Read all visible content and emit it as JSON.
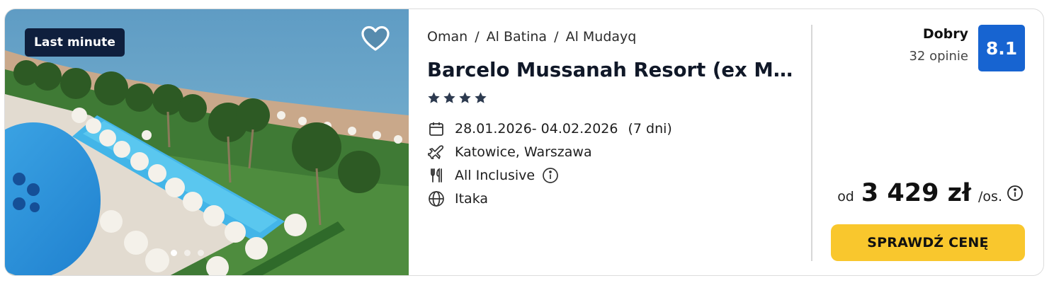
{
  "photo": {
    "badge": "Last minute",
    "favorite_icon": "heart-outline-icon",
    "carousel_dots": 3,
    "carousel_active_index": 0
  },
  "hotel": {
    "breadcrumb": [
      "Oman",
      "Al Batina",
      "Al Mudayq"
    ],
    "breadcrumb_separator": "/",
    "more_label": "•••",
    "name": "Barcelo Mussanah Resort (ex Mil...",
    "stars": 4,
    "dates": "28.01.2026- 04.02.2026",
    "nights": "(7 dni)",
    "departure": "Katowice, Warszawa",
    "board": "All Inclusive",
    "operator": "Itaka"
  },
  "rating": {
    "label": "Dobry",
    "reviews": "32 opinie",
    "score": "8.1"
  },
  "price": {
    "prefix": "od",
    "amount": "3 429 zł",
    "suffix": "/os."
  },
  "cta_label": "SPRAWDŹ CENĘ",
  "colors": {
    "badge_bg": "#0f1f3d",
    "score_bg": "#1764d1",
    "cta_bg": "#f9c72d",
    "star": "#2d3a4f"
  }
}
